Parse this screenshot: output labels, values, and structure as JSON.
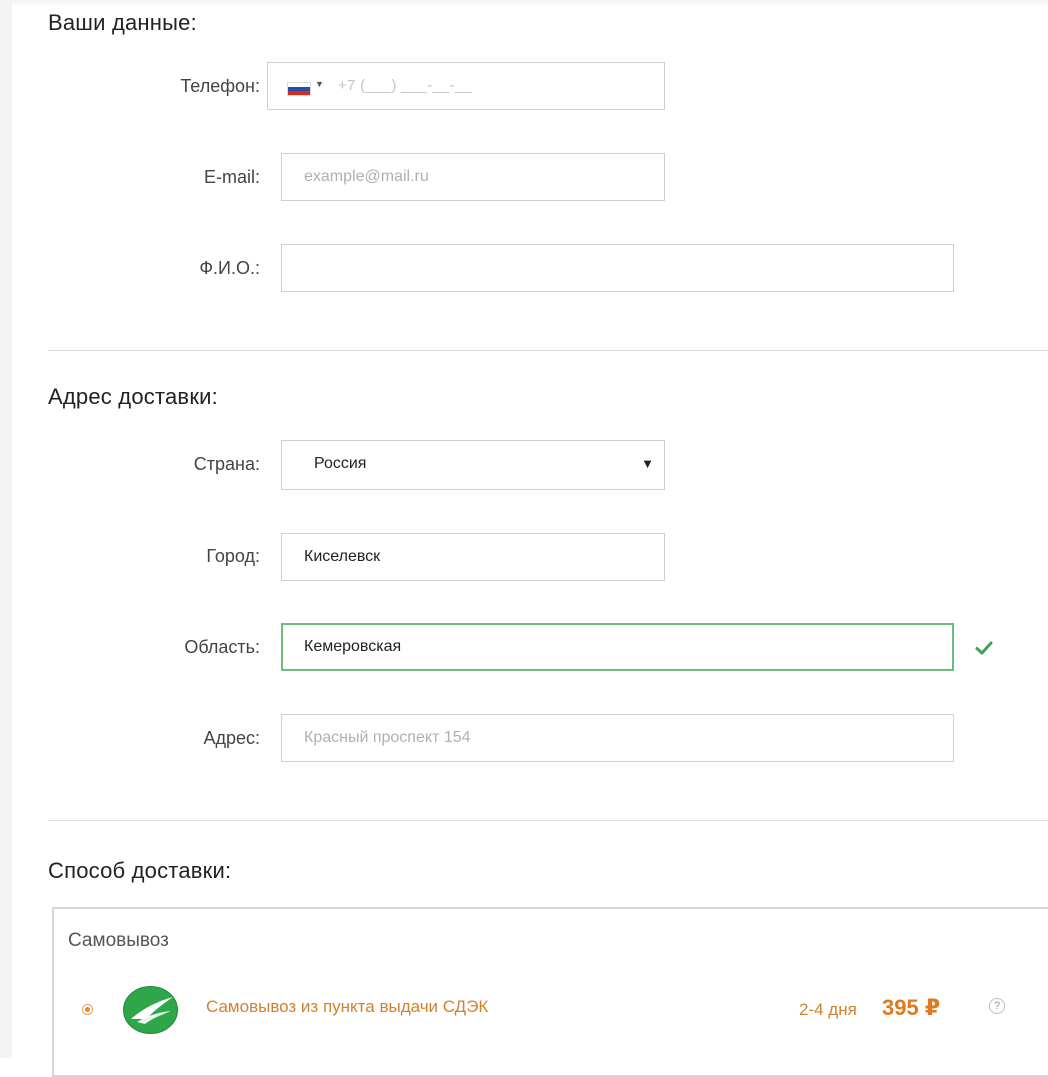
{
  "personal": {
    "title": "Ваши данные:",
    "phone_label": "Телефон:",
    "phone_mask": "+7 (___) ___-__-__",
    "email_label": "E-mail:",
    "email_placeholder": "example@mail.ru",
    "email_value": "",
    "fio_label": "Ф.И.О.:",
    "fio_value": ""
  },
  "address": {
    "title": "Адрес доставки:",
    "country_label": "Страна:",
    "country_value": "Россия",
    "city_label": "Город:",
    "city_value": "Киселевск",
    "region_label": "Область:",
    "region_value": "Кемеровская",
    "address_label": "Адрес:",
    "address_placeholder": "Красный проспект 154",
    "address_value": ""
  },
  "delivery": {
    "title": "Способ доставки:",
    "group_label": "Самовывоз",
    "option_label": "Самовывоз из пункта выдачи СДЭК",
    "option_days": "2-4 дня",
    "option_price": "395 ₽",
    "help_label": "?"
  },
  "icons": {
    "flag": "russia-flag-icon",
    "check": "check-icon",
    "logo": "cdek-logo",
    "help": "help-icon"
  },
  "colors": {
    "accent_orange": "#d1822f",
    "price_orange": "#e07a1f",
    "valid_green": "#6bbd7d",
    "check_green": "#3aa655"
  }
}
